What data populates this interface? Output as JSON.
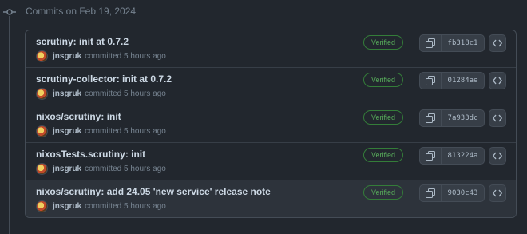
{
  "group": {
    "title": "Commits on Feb 19, 2024"
  },
  "commits": [
    {
      "message": "scrutiny: init at 0.7.2",
      "author": "jnsgruk",
      "time": "committed 5 hours ago",
      "badge": "Verified",
      "sha": "fb318c1"
    },
    {
      "message": "scrutiny-collector: init at 0.7.2",
      "author": "jnsgruk",
      "time": "committed 5 hours ago",
      "badge": "Verified",
      "sha": "01284ae"
    },
    {
      "message": "nixos/scrutiny: init",
      "author": "jnsgruk",
      "time": "committed 5 hours ago",
      "badge": "Verified",
      "sha": "7a933dc"
    },
    {
      "message": "nixosTests.scrutiny: init",
      "author": "jnsgruk",
      "time": "committed 5 hours ago",
      "badge": "Verified",
      "sha": "813224a"
    },
    {
      "message": "nixos/scrutiny: add 24.05 'new service' release note",
      "author": "jnsgruk",
      "time": "committed 5 hours ago",
      "badge": "Verified",
      "sha": "9030c43"
    }
  ],
  "icons": {
    "timeline": "git-commit-icon",
    "copy": "copy-icon",
    "browse": "code-icon"
  },
  "colors": {
    "background": "#22272e",
    "verified": "#57ab5a",
    "border": "#444c56"
  }
}
